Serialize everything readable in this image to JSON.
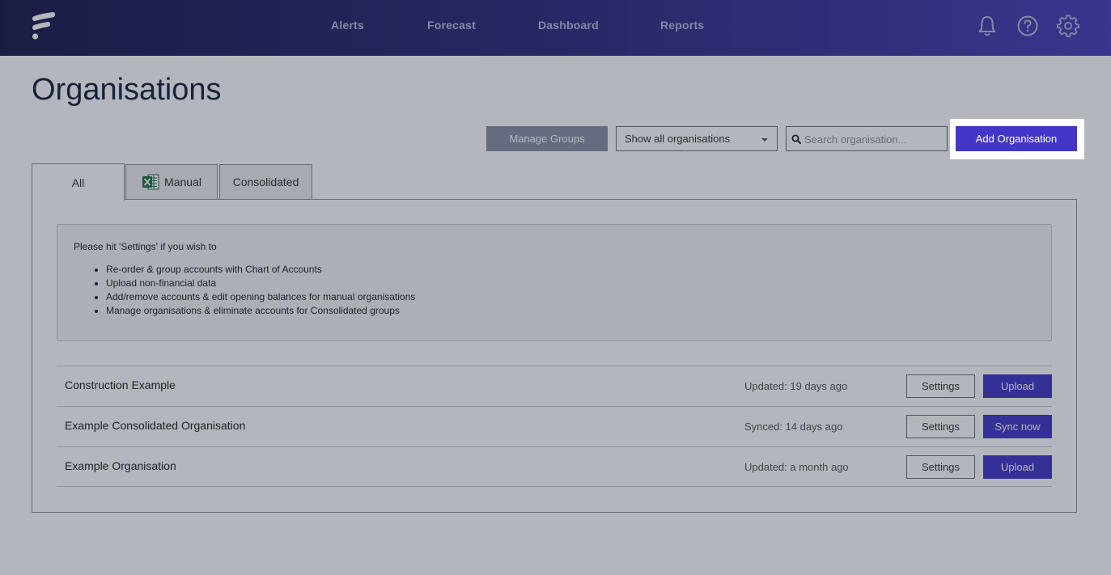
{
  "nav": {
    "items": [
      "Alerts",
      "Forecast",
      "Dashboard",
      "Reports"
    ],
    "icons": [
      "bell-icon",
      "help-icon",
      "gear-icon"
    ]
  },
  "page": {
    "title": "Organisations"
  },
  "toolbar": {
    "manage_groups_label": "Manage Groups",
    "filter_selected": "Show all organisations",
    "search_placeholder": "Search organisation...",
    "add_label": "Add Organisation"
  },
  "tabs": [
    {
      "label": "All"
    },
    {
      "label": "Manual",
      "icon": "excel-icon"
    },
    {
      "label": "Consolidated"
    }
  ],
  "info": {
    "intro": "Please hit 'Settings' if you wish to",
    "items": [
      "Re-order & group accounts with Chart of Accounts",
      "Upload non-financial data",
      "Add/remove accounts & edit opening balances for manual organisations",
      "Manage organisations & eliminate accounts for Consolidated groups"
    ]
  },
  "organisations": [
    {
      "name": "Construction Example",
      "status": "Updated: 19 days ago",
      "settings_label": "Settings",
      "action_label": "Upload"
    },
    {
      "name": "Example Consolidated Organisation",
      "status": "Synced: 14 days ago",
      "settings_label": "Settings",
      "action_label": "Sync now"
    },
    {
      "name": "Example Organisation",
      "status": "Updated: a month ago",
      "settings_label": "Settings",
      "action_label": "Upload"
    }
  ],
  "colors": {
    "accent": "#4236c8",
    "nav_start": "#1a1b4a",
    "nav_end": "#4a3fb8",
    "overlay": "rgba(26,32,54,0.33)"
  }
}
